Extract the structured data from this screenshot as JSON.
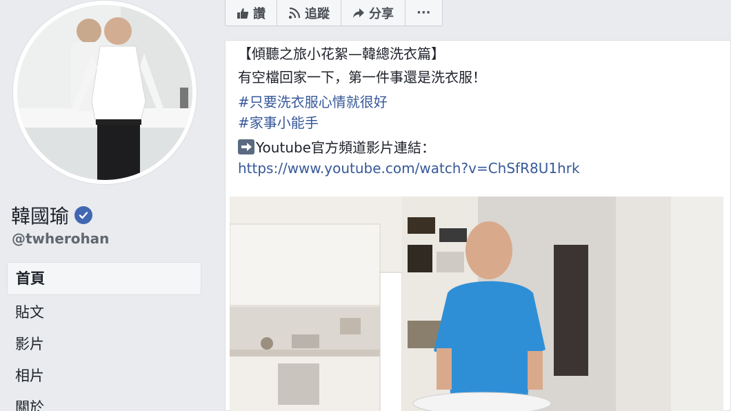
{
  "profile": {
    "name": "韓國瑜",
    "handle": "@twherohan"
  },
  "nav": {
    "items": [
      {
        "label": "首頁"
      },
      {
        "label": "貼文"
      },
      {
        "label": "影片"
      },
      {
        "label": "相片"
      },
      {
        "label": "關於"
      }
    ]
  },
  "actions": {
    "like": "讚",
    "follow": "追蹤",
    "share": "分享",
    "more": "···"
  },
  "post": {
    "title": "【傾聽之旅小花絮—韓總洗衣篇】",
    "line1": "有空檔回家一下，第一件事還是洗衣服！",
    "hashtag1": "#只要洗衣服心情就很好",
    "hashtag2": "#家事小能手",
    "youtube_label": "Youtube官方頻道影片連結：",
    "url": "https://www.youtube.com/watch?v=ChSfR8U1hrk"
  },
  "colors": {
    "link": "#365899",
    "verified": "#4267b2",
    "background": "#e9ebee"
  }
}
